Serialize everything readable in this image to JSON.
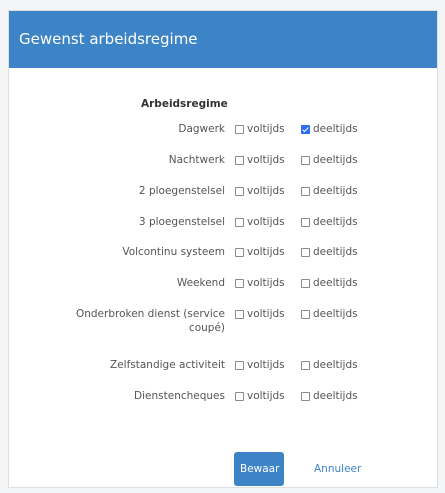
{
  "panel": {
    "title": "Gewenst arbeidsregime",
    "section_title": "Arbeidsregime"
  },
  "rows": [
    {
      "label": "Dagwerk",
      "opt1": "voltijds",
      "opt1_checked": false,
      "opt2": "deeltijds",
      "opt2_checked": true
    },
    {
      "label": "Nachtwerk",
      "opt1": "voltijds",
      "opt1_checked": false,
      "opt2": "deeltijds",
      "opt2_checked": false
    },
    {
      "label": "2 ploegenstelsel",
      "opt1": "voltijds",
      "opt1_checked": false,
      "opt2": "deeltijds",
      "opt2_checked": false
    },
    {
      "label": "3 ploegenstelsel",
      "opt1": "voltijds",
      "opt1_checked": false,
      "opt2": "deeltijds",
      "opt2_checked": false
    },
    {
      "label": "Volcontinu systeem",
      "opt1": "voltijds",
      "opt1_checked": false,
      "opt2": "deeltijds",
      "opt2_checked": false
    },
    {
      "label": "Weekend",
      "opt1": "voltijds",
      "opt1_checked": false,
      "opt2": "deeltijds",
      "opt2_checked": false
    },
    {
      "label": "Onderbroken dienst (service coupé)",
      "opt1": "voltijds",
      "opt1_checked": false,
      "opt2": "deeltijds",
      "opt2_checked": false
    },
    {
      "label": "Zelfstandige activiteit",
      "opt1": "voltijds",
      "opt1_checked": false,
      "opt2": "deeltijds",
      "opt2_checked": false
    },
    {
      "label": "Dienstencheques",
      "opt1": "voltijds",
      "opt1_checked": false,
      "opt2": "deeltijds",
      "opt2_checked": false
    }
  ],
  "actions": {
    "save_label": "Bewaar",
    "cancel_label": "Annuleer"
  },
  "colors": {
    "header": "#3d84c6",
    "checkbox_checked": "#2e6ff2"
  }
}
